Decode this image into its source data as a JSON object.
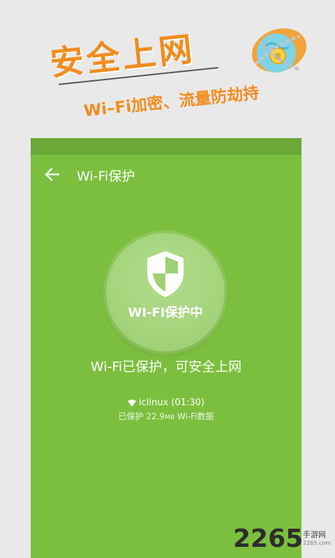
{
  "promo": {
    "title": "安全上网",
    "subtitle": "Wi–Fi加密、流量防劫持",
    "illustration_icon": "locked-globe-icon"
  },
  "app": {
    "toolbar": {
      "back_icon": "arrow-left-icon",
      "title": "Wi-Fi保护"
    },
    "protect_button": {
      "icon": "shield-icon",
      "label": "WI-FI保护中"
    },
    "status_text": "Wi-Fi已保护，可安全上网",
    "network": {
      "icon": "wifi-icon",
      "name": "iclinux (01:30)",
      "usage_prefix": "已保护 22.9",
      "usage_unit": "MB",
      "usage_suffix": " Wi-Fi数据"
    }
  },
  "watermark": {
    "number": "2265",
    "text": "手游网",
    "url": "2265.com"
  },
  "colors": {
    "accent_orange": "#f28c1e",
    "screen_green": "#7cbf3f",
    "statusbar_green": "#6aa837"
  }
}
